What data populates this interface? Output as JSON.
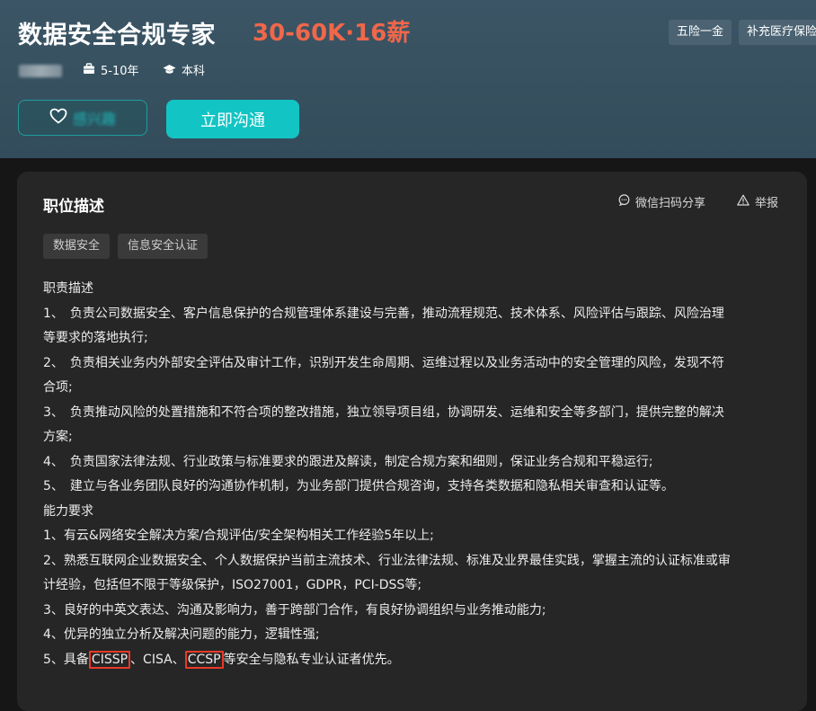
{
  "header": {
    "title": "数据安全合规专家",
    "salary": "30-60K·16薪",
    "benefits": [
      "五险一金",
      "补充医疗保险"
    ],
    "experience": "5-10年",
    "education": "本科",
    "fav_label": "感兴趣",
    "chat_label": "立即沟通"
  },
  "card": {
    "section_title": "职位描述",
    "share_label": "微信扫码分享",
    "report_label": "举报",
    "tags": [
      "数据安全",
      "信息安全认证"
    ],
    "lines": [
      "职责描述",
      "1、　负责公司数据安全、客户信息保护的合规管理体系建设与完善，推动流程规范、技术体系、风险评估与跟踪、风险治理",
      "等要求的落地执行;",
      "2、　负责相关业务内外部安全评估及审计工作，识别开发生命周期、运维过程以及业务活动中的安全管理的风险，发现不符",
      "合项;",
      "3、　负责推动风险的处置措施和不符合项的整改措施，独立领导项目组，协调研发、运维和安全等多部门，提供完整的解决",
      "方案;",
      "4、　负责国家法律法规、行业政策与标准要求的跟进及解读，制定合规方案和细则，保证业务合规和平稳运行;",
      "5、　建立与各业务团队良好的沟通协作机制，为业务部门提供合规咨询，支持各类数据和隐私相关审查和认证等。",
      "能力要求",
      "1、有云&网络安全解决方案/合规评估/安全架构相关工作经验5年以上;",
      "2、熟悉互联网企业数据安全、个人数据保护当前主流技术、行业法律法规、标准及业界最佳实践，掌握主流的认证标准或审",
      "计经验，包括但不限于等级保护，ISO27001，GDPR，PCI-DSS等;",
      "3、良好的中英文表达、沟通及影响力，善于跨部门合作，有良好协调组织与业务推动能力;",
      "4、优异的独立分析及解决问题的能力，逻辑性强;"
    ],
    "last_line": {
      "prefix": "5、具备",
      "cert1": "CISSP",
      "sep1": "、CISA、",
      "cert2": "CCSP",
      "suffix": "等安全与隐私专业认证者优先。"
    }
  },
  "colors": {
    "accent": "#12c4c4",
    "salary": "#f0674a",
    "highlight_box": "#e83a2a"
  }
}
